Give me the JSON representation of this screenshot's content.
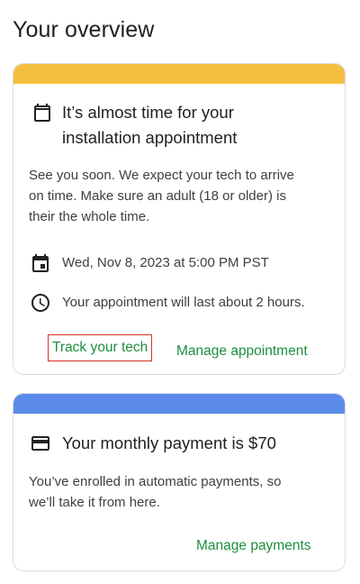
{
  "page": {
    "title": "Your overview"
  },
  "appointment_card": {
    "band_color": "#f4bf3e",
    "headline": "It’s almost time for your installation appointment",
    "headline_line1": "It’s almost time for your",
    "headline_line2": "installation appointment",
    "body_line1": "See you soon. We expect your tech to arrive",
    "body_line2": "on time. Make sure an adult (18 or older) is",
    "body_line3": "their the whole time.",
    "date_time": "Wed, Nov 8, 2023 at 5:00 PM PST",
    "duration": "Your appointment will last about 2 hours.",
    "track_label": "Track your tech",
    "manage_label": "Manage appointment",
    "icons": {
      "header": "calendar-icon",
      "date": "event-icon",
      "duration": "clock-icon"
    }
  },
  "payment_card": {
    "band_color": "#5b8bea",
    "headline": "Your monthly payment is $70",
    "body_line1": "You’ve enrolled in automatic payments, so",
    "body_line2": "we’ll take it from here.",
    "manage_label": "Manage payments",
    "icons": {
      "header": "credit-card-icon"
    }
  },
  "colors": {
    "link": "#1e8e3e",
    "highlight_border": "#d93025"
  }
}
